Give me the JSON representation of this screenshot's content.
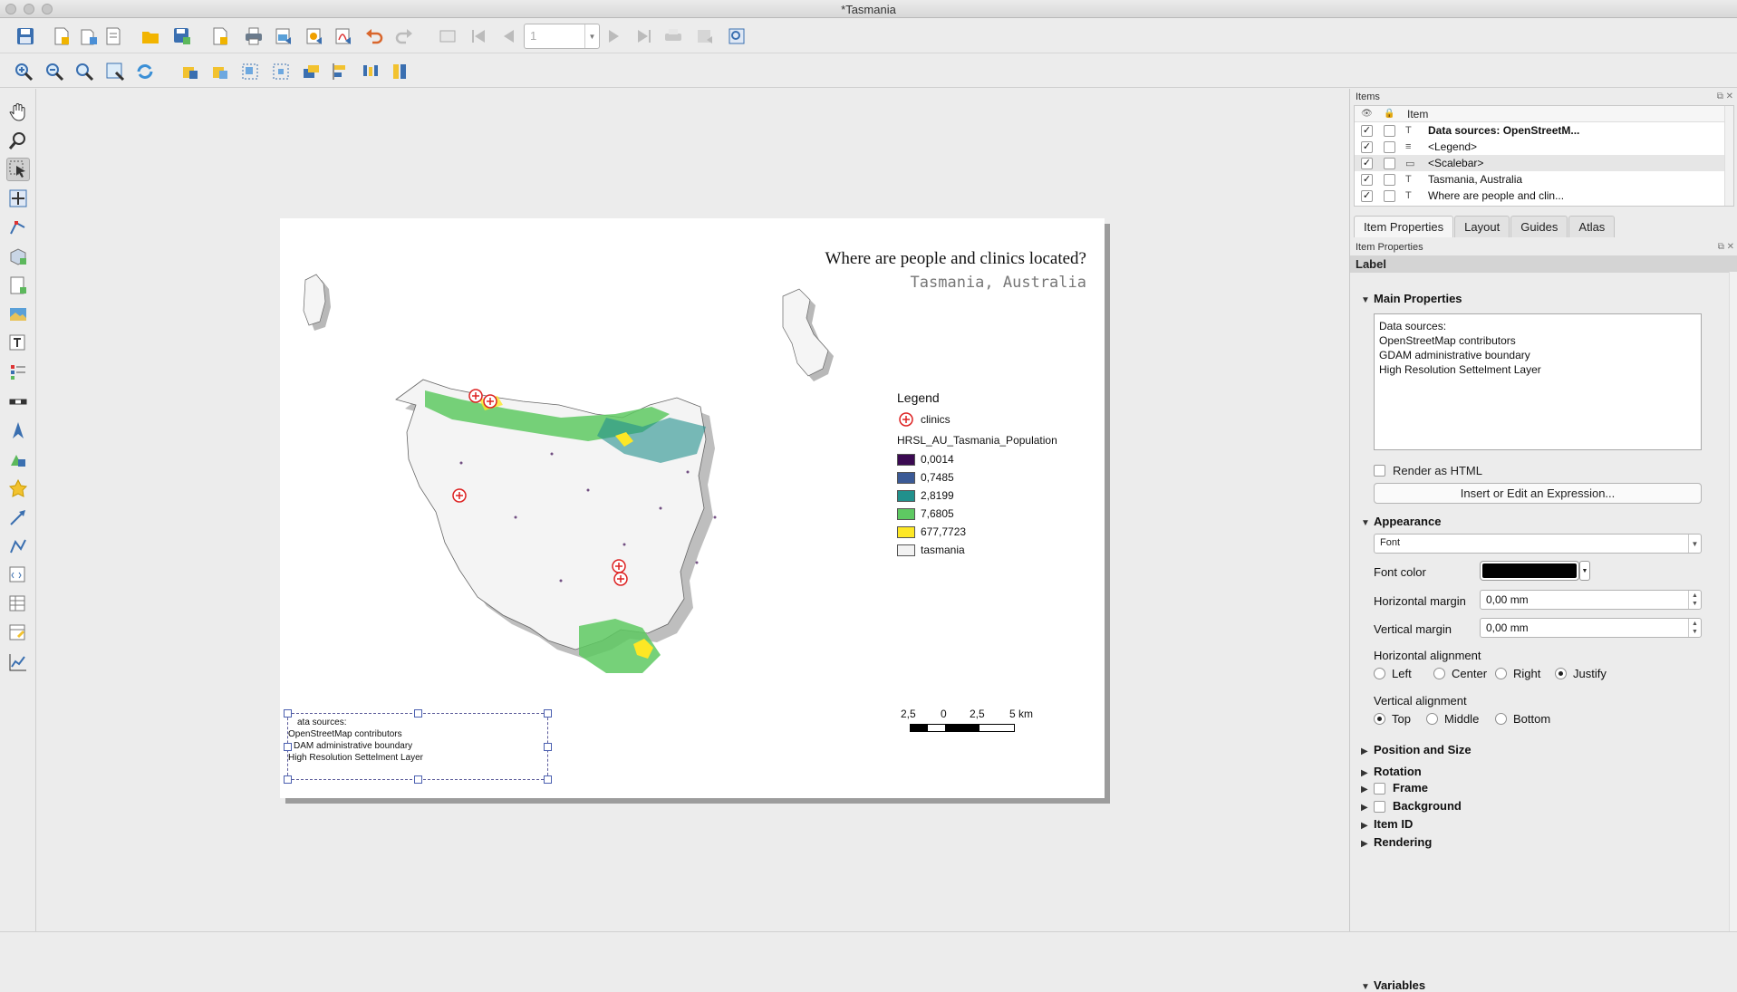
{
  "window": {
    "title": "*Tasmania"
  },
  "toolbar1": {
    "page_number": "1"
  },
  "map": {
    "title": "Where are people and clinics located?",
    "subtitle": "Tasmania, Australia",
    "legend": {
      "title": "Legend",
      "clinics_label": "clinics",
      "population_layer": "HRSL_AU_Tasmania_Population",
      "classes": [
        {
          "label": "0,0014",
          "color": "#3b0a52"
        },
        {
          "label": "0,7485",
          "color": "#3b5a96"
        },
        {
          "label": "2,8199",
          "color": "#21908c"
        },
        {
          "label": "7,6805",
          "color": "#5ec962"
        },
        {
          "label": "677,7723",
          "color": "#fde725"
        },
        {
          "label": "tasmania",
          "color": "#f2f2f2"
        }
      ]
    },
    "scalebar": {
      "labels": [
        "2,5",
        "0",
        "2,5",
        "5 km"
      ]
    },
    "data_sources_lines": [
      "Data sources:",
      "OpenStreetMap contributors",
      "GDAM administrative boundary",
      "High Resolution Settelment Layer"
    ],
    "data_sources_visible": [
      "ata sources:",
      "OpenStreetMap contributors",
      "DAM administrative boundary",
      "High Resolution Settelment Layer"
    ]
  },
  "items_panel": {
    "dock_title": "Items",
    "column_item": "Item",
    "rows": [
      {
        "label": "Data sources: OpenStreetM...",
        "bold": true,
        "icon": "T",
        "checked": "✓"
      },
      {
        "label": "<Legend>",
        "bold": false,
        "icon": "≡",
        "checked": "✓"
      },
      {
        "label": "<Scalebar>",
        "bold": false,
        "icon": "▭",
        "checked": "✓"
      },
      {
        "label": "Tasmania, Australia",
        "bold": false,
        "icon": "T",
        "checked": "✓"
      },
      {
        "label": "Where are people and clin...",
        "bold": false,
        "icon": "T",
        "checked": "✓"
      }
    ]
  },
  "tabs": {
    "item_properties": "Item Properties",
    "layout": "Layout",
    "guides": "Guides",
    "atlas": "Atlas"
  },
  "properties": {
    "dock_title": "Item Properties",
    "item_type": "Label",
    "main_section": "Main Properties",
    "label_text_lines": [
      "Data sources:",
      "OpenStreetMap contributors",
      "GDAM administrative boundary",
      "High Resolution Settelment Layer"
    ],
    "render_html": "Render as HTML",
    "expression_button": "Insert or Edit an Expression...",
    "appearance_section": "Appearance",
    "font_button": "Font",
    "font_color_label": "Font color",
    "font_color": "#000000",
    "hmargin_label": "Horizontal margin",
    "hmargin_value": "0,00 mm",
    "vmargin_label": "Vertical margin",
    "vmargin_value": "0,00 mm",
    "halign_label": "Horizontal alignment",
    "halign_options": [
      "Left",
      "Center",
      "Right",
      "Justify"
    ],
    "halign_selected": "Justify",
    "valign_label": "Vertical alignment",
    "valign_options": [
      "Top",
      "Middle",
      "Bottom"
    ],
    "valign_selected": "Top",
    "collapsed_sections": [
      "Position and Size",
      "Rotation",
      "Frame",
      "Background",
      "Item ID",
      "Rendering"
    ],
    "variables_section": "Variables"
  }
}
